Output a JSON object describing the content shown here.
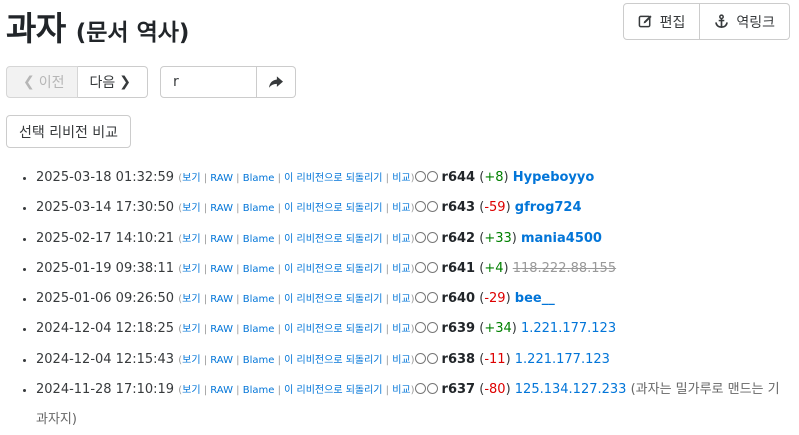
{
  "page": {
    "title_main": "과자",
    "title_sub": "(문서 역사)"
  },
  "actions": {
    "edit_label": "편집",
    "backlinks_label": "역링크"
  },
  "pager": {
    "prev_label": "이전",
    "next_label": "다음"
  },
  "search": {
    "value": "r"
  },
  "compare_label": "선택 리비전 비교",
  "link_labels": {
    "view": "보기",
    "raw": "RAW",
    "blame": "Blame",
    "revert": "이 리비전으로 되돌리기",
    "compare": "비교"
  },
  "revisions": [
    {
      "date": "2025-03-18 01:32:59",
      "rev": "r644",
      "diff": "+8",
      "user": "Hypeboyyo",
      "log": ""
    },
    {
      "date": "2025-03-14 17:30:50",
      "rev": "r643",
      "diff": "-59",
      "user": "gfrog724",
      "log": ""
    },
    {
      "date": "2025-02-17 14:10:21",
      "rev": "r642",
      "diff": "+33",
      "user": "mania4500",
      "log": ""
    },
    {
      "date": "2025-01-19 09:38:11",
      "rev": "r641",
      "diff": "+4",
      "user": "118.222.88.155",
      "log": ""
    },
    {
      "date": "2025-01-06 09:26:50",
      "rev": "r640",
      "diff": "-29",
      "user": "bee__",
      "log": ""
    },
    {
      "date": "2024-12-04 12:18:25",
      "rev": "r639",
      "diff": "+34",
      "user": "1.221.177.123",
      "log": ""
    },
    {
      "date": "2024-12-04 12:15:43",
      "rev": "r638",
      "diff": "-11",
      "user": "1.221.177.123",
      "log": ""
    },
    {
      "date": "2024-11-28 17:10:19",
      "rev": "r637",
      "diff": "-80",
      "user": "125.134.127.233",
      "log": "(과자는 밀가루로 맨드는 기 과자지)"
    }
  ],
  "colors": {
    "link": "#0275d8",
    "plus": "#008000",
    "minus": "#dd0000",
    "muted": "#999999"
  }
}
